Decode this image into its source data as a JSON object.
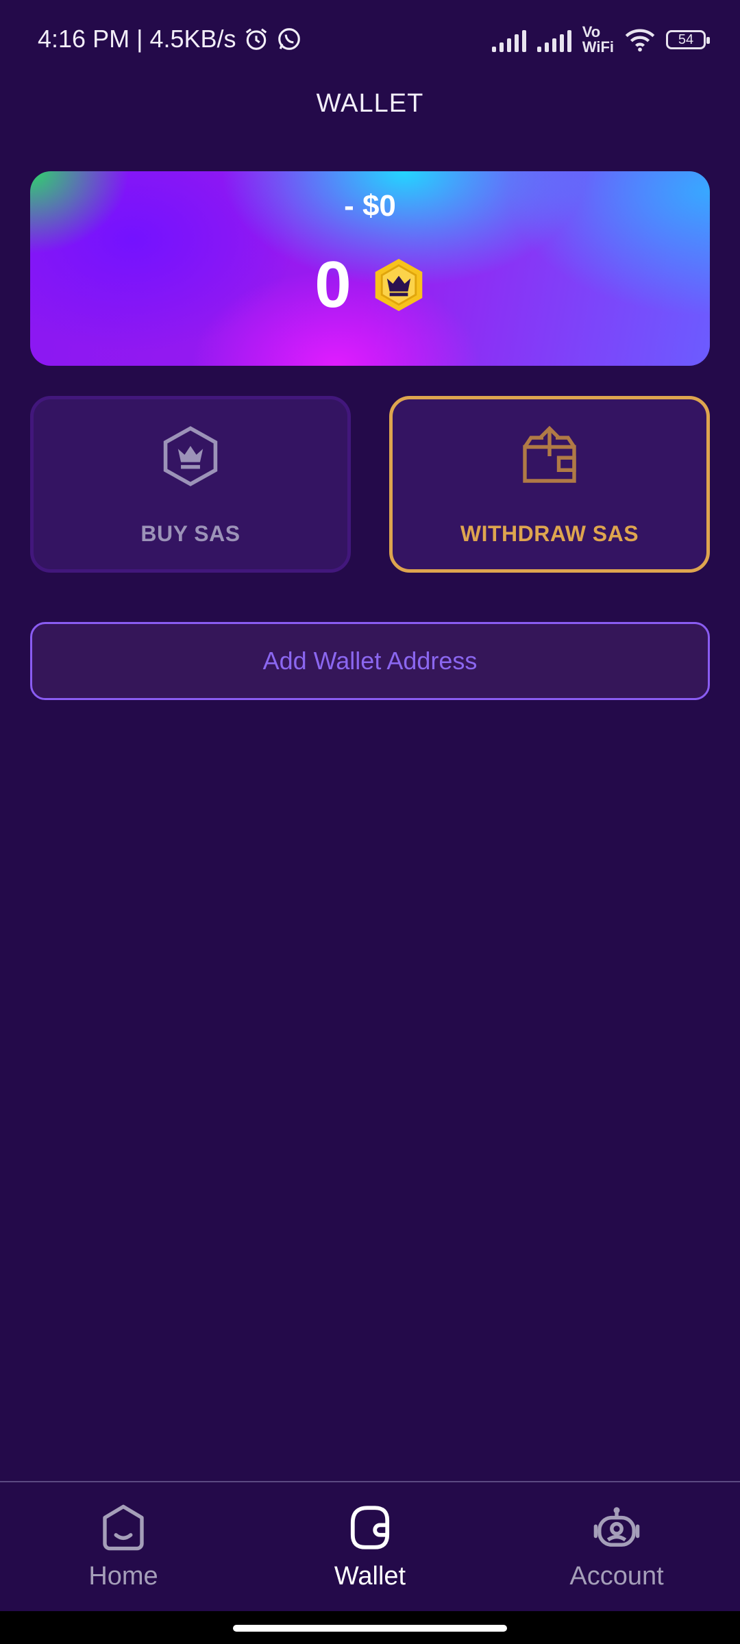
{
  "status_bar": {
    "time": "4:16 PM",
    "separator": "|",
    "speed": "4.5KB/s",
    "vowifi_top": "Vo",
    "vowifi_bottom": "WiFi",
    "battery": "54",
    "icons": [
      "alarm-icon",
      "whatsapp-icon",
      "signal-icon",
      "signal-icon",
      "wifi-icon",
      "battery-icon"
    ]
  },
  "header": {
    "title": "WALLET"
  },
  "balance": {
    "usd": "- $0",
    "sas_amount": "0",
    "coin_icon": "crown-coin-icon"
  },
  "actions": {
    "buy": {
      "label": "BUY SAS",
      "icon": "crown-hexagon-icon"
    },
    "withdraw": {
      "label": "WITHDRAW SAS",
      "icon": "wallet-upload-icon"
    }
  },
  "add_wallet": {
    "label": "Add Wallet Address"
  },
  "bottom_nav": {
    "items": [
      {
        "label": "Home",
        "icon": "home-icon",
        "active": false
      },
      {
        "label": "Wallet",
        "icon": "wallet-icon",
        "active": true
      },
      {
        "label": "Account",
        "icon": "robot-icon",
        "active": false
      }
    ]
  },
  "colors": {
    "background": "#240a4a",
    "accent_gold": "#dea54f",
    "accent_purple": "#8a5cf2",
    "card": "#341462"
  }
}
